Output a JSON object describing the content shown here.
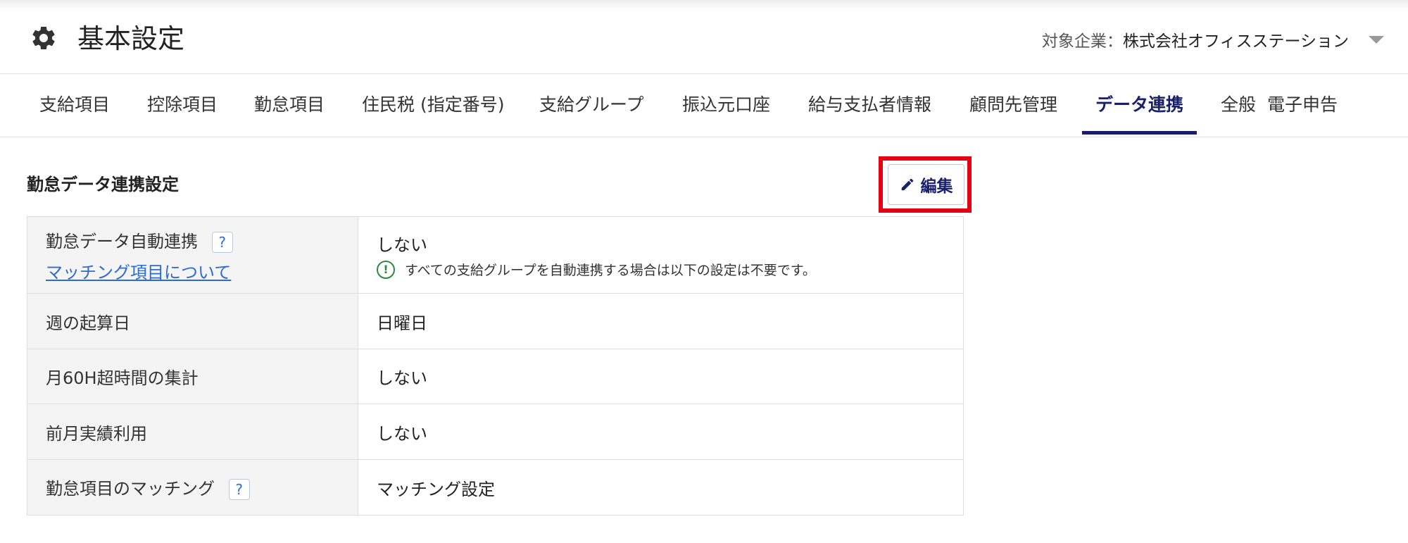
{
  "header": {
    "title": "基本設定",
    "company_label": "対象企業：",
    "company_name": "株式会社オフィスステーション"
  },
  "tabs": [
    {
      "label": "支給項目",
      "active": false
    },
    {
      "label": "控除項目",
      "active": false
    },
    {
      "label": "勤怠項目",
      "active": false
    },
    {
      "label": "住民税 (指定番号)",
      "active": false
    },
    {
      "label": "支給グループ",
      "active": false
    },
    {
      "label": "振込元口座",
      "active": false
    },
    {
      "label": "給与支払者情報",
      "active": false
    },
    {
      "label": "顧問先管理",
      "active": false
    },
    {
      "label": "データ連携",
      "active": true
    },
    {
      "label": "全般",
      "active": false
    },
    {
      "label": "電子申告",
      "active": false
    }
  ],
  "section": {
    "title": "勤怠データ連携設定",
    "edit_label": "編集"
  },
  "rows": [
    {
      "label": "勤怠データ自動連携",
      "help": "?",
      "link": "マッチング項目について",
      "value": "しない",
      "note": "すべての支給グループを自動連携する場合は以下の設定は不要です。"
    },
    {
      "label": "週の起算日",
      "value": "日曜日"
    },
    {
      "label": "月60H超時間の集計",
      "value": "しない"
    },
    {
      "label": "前月実績利用",
      "value": "しない"
    },
    {
      "label": "勤怠項目のマッチング",
      "help": "?",
      "value": "マッチング設定"
    }
  ],
  "colors": {
    "accent": "#1a1f6b",
    "highlight": "#e60012",
    "link": "#2d6bd4",
    "note_icon": "#2e8b3e"
  }
}
